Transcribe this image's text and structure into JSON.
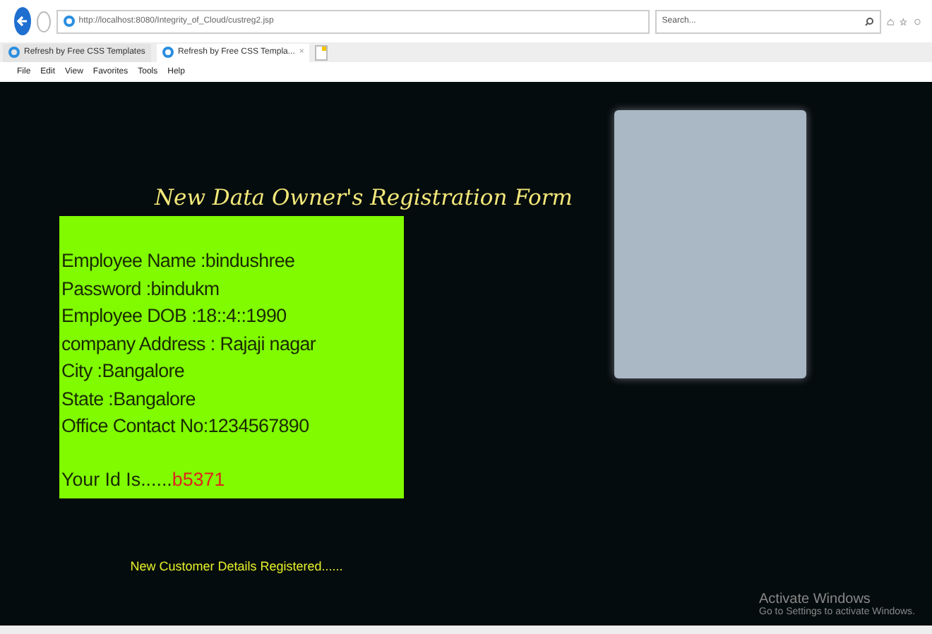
{
  "browser": {
    "address": "http://localhost:8080/Integrity_of_Cloud/custreg2.jsp",
    "search": {
      "placeholder": "Search..."
    },
    "tabs": [
      {
        "label": "Refresh by Free CSS Templates",
        "selected": false
      },
      {
        "label": "Refresh by Free CSS Templa...",
        "selected": true,
        "close": "×"
      }
    ],
    "menu": [
      "File",
      "Edit",
      "View",
      "Favorites",
      "Tools",
      "Help"
    ]
  },
  "page": {
    "title": "New Data Owner's Registration Form",
    "details": [
      "Employee Name :bindushree",
      "Password :bindukm",
      "Employee DOB :18::4::1990",
      "company Address : Rajaji nagar",
      "City :Bangalore",
      "State :Bangalore",
      "Office Contact No:1234567890"
    ],
    "id_label": "Your Id Is......",
    "id_value": "b5371",
    "footer": "New Customer Details Registered......"
  },
  "activation": {
    "title": "Activate Windows",
    "subtitle": "Go to Settings to activate Windows."
  }
}
